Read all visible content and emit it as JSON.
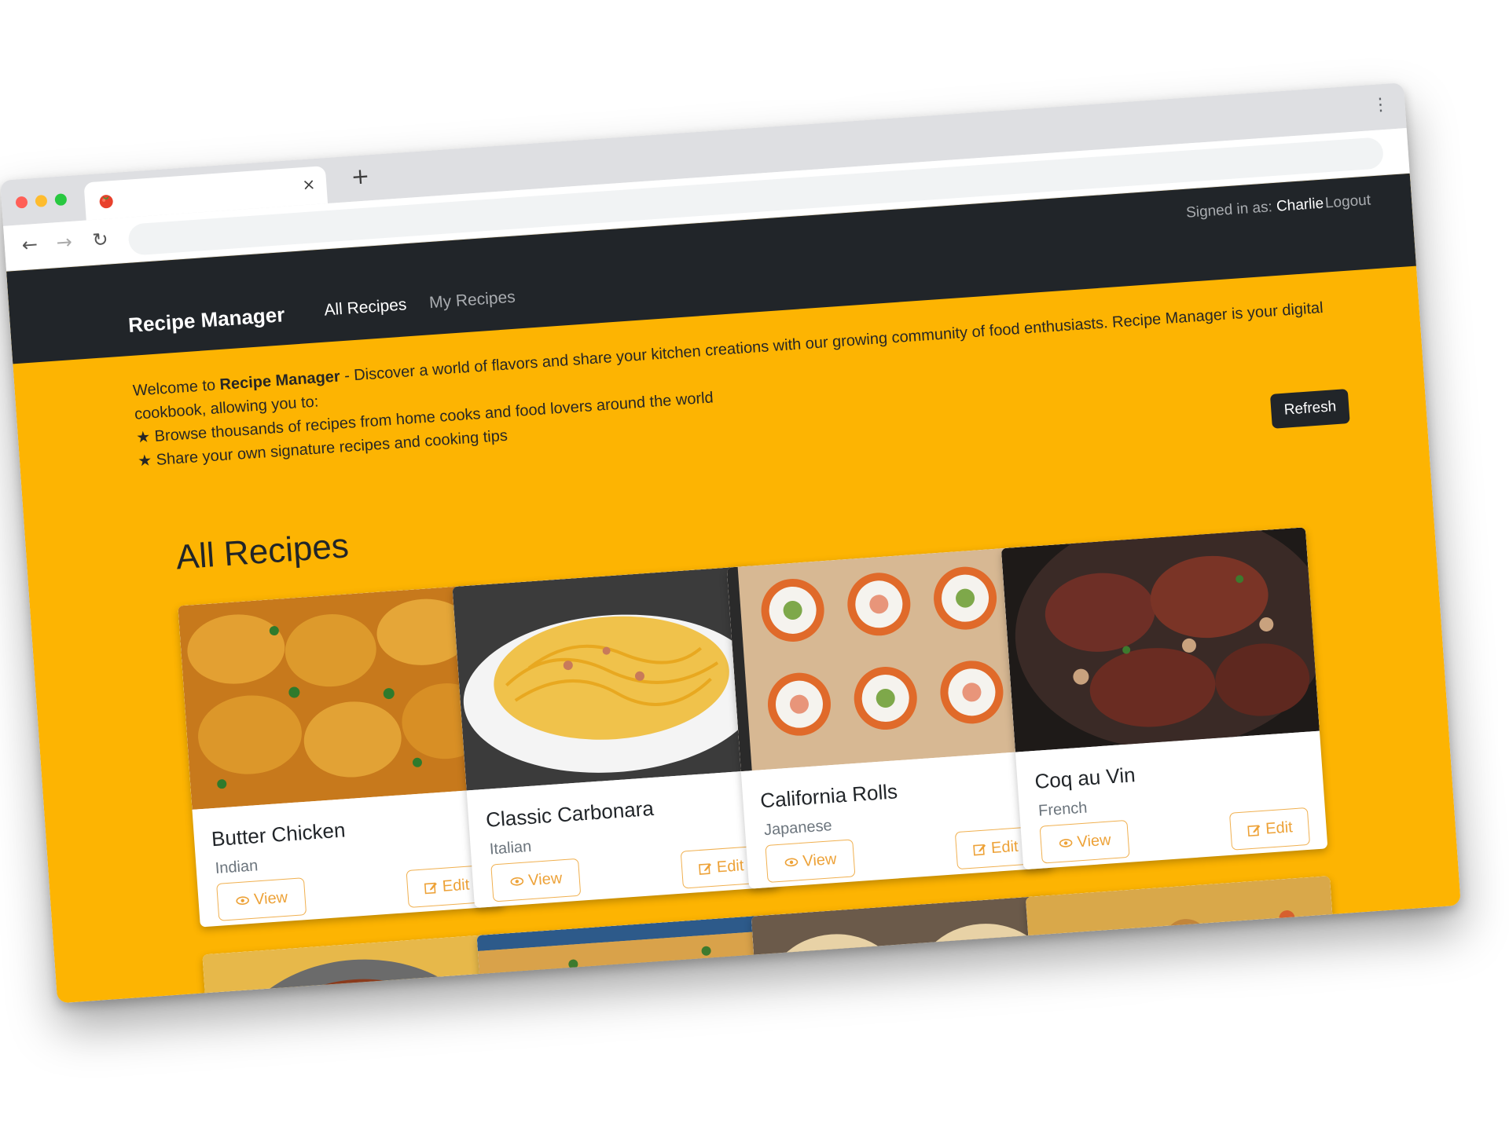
{
  "browser": {
    "tab": {
      "title": "",
      "favicon": "tomato-icon",
      "close": "×"
    },
    "new_tab": "+",
    "menu": "⋮",
    "nav": {
      "back": "←",
      "forward": "→",
      "reload": "↻"
    },
    "address": ""
  },
  "colors": {
    "page_background": "#fdb402",
    "navbar": "#212529",
    "button_outline": "#f0b050",
    "refresh_button": "#212529"
  },
  "header": {
    "signed_in_prefix": "Signed in as:",
    "user": "Charlie",
    "logout": "Logout",
    "brand": "Recipe Manager",
    "nav": [
      {
        "label": "All Recipes",
        "active": true
      },
      {
        "label": "My Recipes",
        "active": false
      }
    ]
  },
  "intro": {
    "welcome_prefix": "Welcome to ",
    "app_name": "Recipe Manager",
    "text": " - Discover a world of flavors and share your kitchen creations with our growing community of food enthusiasts. Recipe Manager is your digital cookbook, allowing you to:",
    "bullets": [
      "★ Browse thousands of recipes from home cooks and food lovers around the world",
      "★ Share your own signature recipes and cooking tips"
    ]
  },
  "refresh_label": "Refresh",
  "section_title": "All Recipes",
  "recipes": [
    {
      "name": "Butter Chicken",
      "cuisine": "Indian",
      "image": "butter-chicken-photo"
    },
    {
      "name": "Classic Carbonara",
      "cuisine": "Italian",
      "image": "carbonara-photo"
    },
    {
      "name": "California Rolls",
      "cuisine": "Japanese",
      "image": "sushi-rolls-photo"
    },
    {
      "name": "Coq au Vin",
      "cuisine": "French",
      "image": "coq-au-vin-photo"
    }
  ],
  "more_recipe_images": [
    "stir-fry-chicken-photo",
    "lasagna-photo",
    "tacos-photo",
    "vegetable-stew-photo"
  ],
  "card_buttons": {
    "view": "View",
    "edit": "Edit",
    "view_icon": "eye-icon",
    "edit_icon": "pencil-square-icon"
  }
}
